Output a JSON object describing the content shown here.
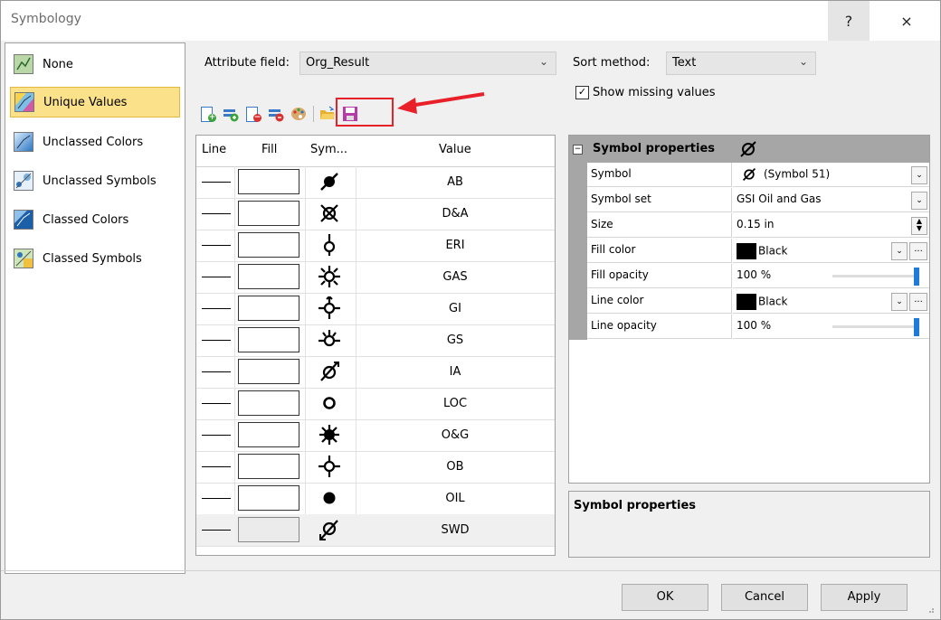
{
  "window": {
    "title": "Symbology",
    "help_label": "?",
    "close_label": "×"
  },
  "left_panel": {
    "items": [
      {
        "label": "None",
        "icon": "none-icon",
        "selected": false
      },
      {
        "label": "Unique Values",
        "icon": "unique-values-icon",
        "selected": true
      },
      {
        "label": "Unclassed Colors",
        "icon": "unclassed-colors-icon",
        "selected": false
      },
      {
        "label": "Unclassed Symbols",
        "icon": "unclassed-symbols-icon",
        "selected": false
      },
      {
        "label": "Classed Colors",
        "icon": "classed-colors-icon",
        "selected": false
      },
      {
        "label": "Classed Symbols",
        "icon": "classed-symbols-icon",
        "selected": false
      }
    ]
  },
  "attribute": {
    "label": "Attribute field:",
    "value": "Org_Result"
  },
  "sort": {
    "label": "Sort method:",
    "value": "Text"
  },
  "missing": {
    "label": "Show missing values",
    "checked": true
  },
  "toolbar": {
    "icons": [
      "add-value-icon",
      "add-all-values-icon",
      "remove-value-icon",
      "remove-all-values-icon",
      "color-palette-icon",
      "open-folder-icon",
      "save-icon"
    ]
  },
  "grid": {
    "headers": {
      "line": "Line",
      "fill": "Fill",
      "symbol": "Sym...",
      "value": "Value"
    },
    "rows": [
      {
        "value": "AB",
        "symbol": "ab-symbol-icon"
      },
      {
        "value": "D&A",
        "symbol": "da-symbol-icon"
      },
      {
        "value": "ERI",
        "symbol": "eri-symbol-icon"
      },
      {
        "value": "GAS",
        "symbol": "gas-symbol-icon"
      },
      {
        "value": "GI",
        "symbol": "gi-symbol-icon"
      },
      {
        "value": "GS",
        "symbol": "gs-symbol-icon"
      },
      {
        "value": "IA",
        "symbol": "ia-symbol-icon"
      },
      {
        "value": "LOC",
        "symbol": "loc-symbol-icon"
      },
      {
        "value": "O&G",
        "symbol": "og-symbol-icon"
      },
      {
        "value": "OB",
        "symbol": "ob-symbol-icon"
      },
      {
        "value": "OIL",
        "symbol": "oil-symbol-icon"
      },
      {
        "value": "SWD",
        "symbol": "swd-symbol-icon",
        "selected": true
      }
    ]
  },
  "props": {
    "title": "Symbol properties",
    "symbol_label": "Symbol",
    "symbol_value": "(Symbol 51)",
    "set_label": "Symbol set",
    "set_value": "GSI Oil and Gas",
    "size_label": "Size",
    "size_value": "0.15 in",
    "fill_color_label": "Fill color",
    "fill_color_value": "Black",
    "fill_opacity_label": "Fill opacity",
    "fill_opacity_value": "100 %",
    "line_color_label": "Line color",
    "line_color_value": "Black",
    "line_opacity_label": "Line opacity",
    "line_opacity_value": "100 %",
    "more_label": "...",
    "description_title": "Symbol properties"
  },
  "buttons": {
    "ok": "OK",
    "cancel": "Cancel",
    "apply": "Apply"
  },
  "colors": {
    "selection": "#fbe18a",
    "highlight": "#e8202a",
    "slider": "#1f7ad8"
  }
}
